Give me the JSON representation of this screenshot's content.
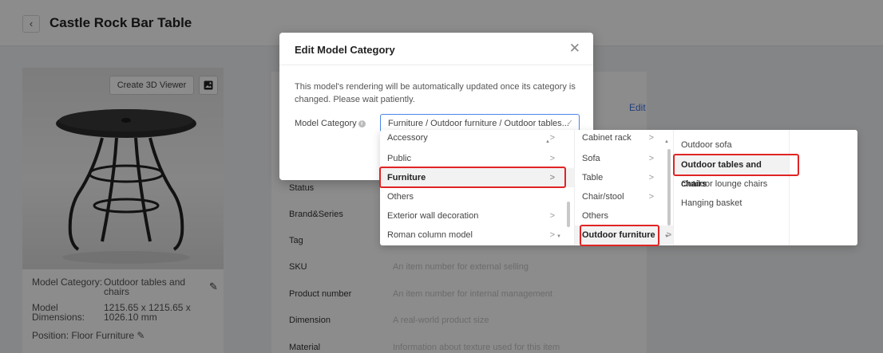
{
  "page": {
    "back_icon": "chevron-left-icon",
    "title": "Castle Rock Bar Table",
    "viewer_button": "Create 3D Viewer",
    "image_icon": "image-icon",
    "model": {
      "category_label": "Model Category:",
      "category_value": "Outdoor tables and chairs",
      "dimensions_label": "Model Dimensions:",
      "dimensions_value": "1215.65 x 1215.65 x 1026.10 mm",
      "position_label": "Position:",
      "position_value": "Floor Furniture"
    },
    "details": {
      "edit_link": "Edit",
      "rows": [
        {
          "label": "Status",
          "placeholder": ""
        },
        {
          "label": "Brand&Series",
          "placeholder": ""
        },
        {
          "label": "Tag",
          "placeholder": ""
        },
        {
          "label": "SKU",
          "placeholder": "An item number for external selling"
        },
        {
          "label": "Product number",
          "placeholder": "An item number for internal management"
        },
        {
          "label": "Dimension",
          "placeholder": "A real-world product size"
        },
        {
          "label": "Material",
          "placeholder": "Information about texture used for this item"
        }
      ]
    }
  },
  "modal": {
    "title": "Edit Model Category",
    "close_icon": "close-icon",
    "description": "This model's rendering will be automatically updated once its category is changed. Please wait patiently.",
    "field_label": "Model Category",
    "field_value": "Furniture / Outdoor furniture / Outdoor tables..."
  },
  "cascader": {
    "level1": [
      {
        "label": "Accessory",
        "arrow": true
      },
      {
        "label": "Public",
        "arrow": true
      },
      {
        "label": "Furniture",
        "arrow": true,
        "selected": true
      },
      {
        "label": "Others",
        "arrow": false
      },
      {
        "label": "Exterior wall decoration",
        "arrow": true
      },
      {
        "label": "Roman column model",
        "arrow": true
      }
    ],
    "level2": [
      {
        "label": "Cabinet rack",
        "arrow": true
      },
      {
        "label": "Sofa",
        "arrow": true
      },
      {
        "label": "Table",
        "arrow": true
      },
      {
        "label": "Chair/stool",
        "arrow": true
      },
      {
        "label": "Others",
        "arrow": false
      },
      {
        "label": "Outdoor furniture",
        "arrow": true,
        "selected": true
      }
    ],
    "level3": [
      {
        "label": "Outdoor sofa"
      },
      {
        "label": "Outdoor tables and chairs",
        "selected": true
      },
      {
        "label": "Outdoor lounge chairs"
      },
      {
        "label": "Hanging basket"
      }
    ],
    "highlight_color": "#e02424",
    "accent_color": "#4a86e8"
  }
}
